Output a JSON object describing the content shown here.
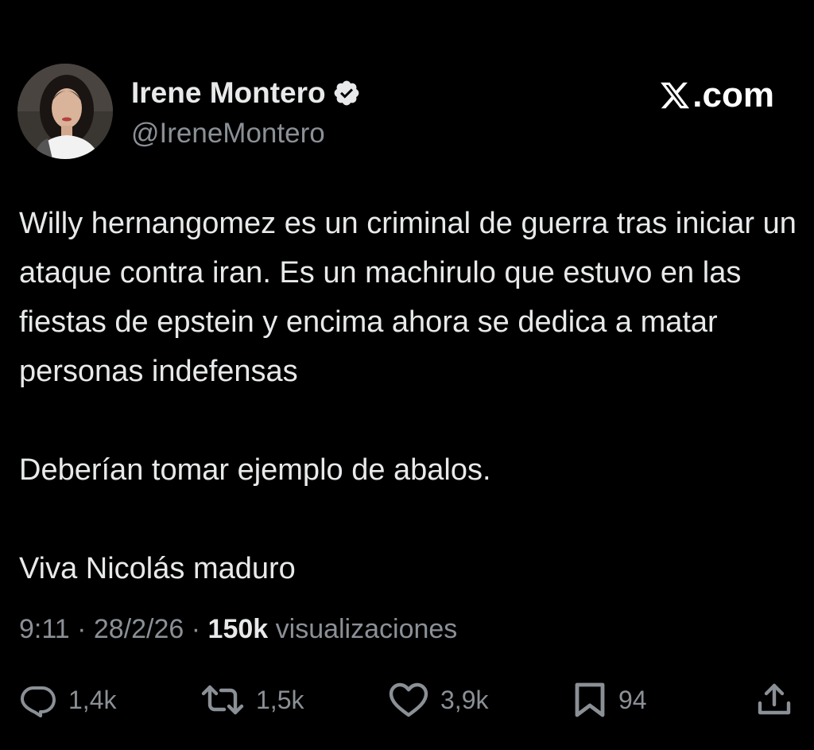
{
  "author": {
    "display_name": "Irene Montero",
    "handle": "@IreneMontero",
    "verified": true
  },
  "brand": {
    "label": ".com",
    "icon": "x-logo-icon"
  },
  "post": {
    "paragraphs": [
      "Willy hernangomez es un criminal de guerra tras iniciar un ataque contra iran. Es un machirulo que estuvo en las fiestas de epstein y encima ahora se dedica a matar personas indefensas",
      "Deberían tomar ejemplo de abalos.",
      "Viva Nicolás maduro"
    ]
  },
  "meta": {
    "time": "9:11",
    "separator": " · ",
    "date": "28/2/26",
    "views_count": "150k",
    "views_label": " visualizaciones"
  },
  "actions": {
    "replies": "1,4k",
    "reposts": "1,5k",
    "likes": "3,9k",
    "bookmarks": "94"
  },
  "colors": {
    "background": "#000000",
    "text": "#e7e9ea",
    "muted": "#8b9096",
    "verified": "#ffffff"
  }
}
